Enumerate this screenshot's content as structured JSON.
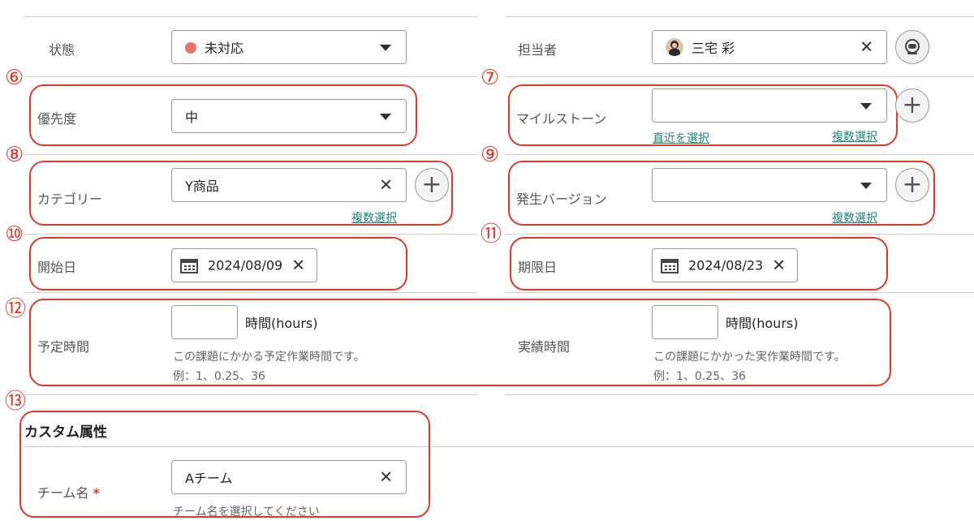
{
  "status": {
    "label": "状態",
    "value": "未対応",
    "dot_color": "#e8736a"
  },
  "assignee": {
    "label": "担当者",
    "value": "三宅 彩"
  },
  "priority": {
    "label": "優先度",
    "value": "中",
    "number": "⑥"
  },
  "milestone": {
    "label": "マイルストーン",
    "value": "",
    "recent_link": "直近を選択",
    "multi_link": "複数選択",
    "number": "⑦"
  },
  "category": {
    "label": "カテゴリー",
    "value": "Y商品",
    "multi_link": "複数選択",
    "number": "⑧"
  },
  "version": {
    "label": "発生バージョン",
    "value": "",
    "multi_link": "複数選択",
    "number": "⑨"
  },
  "start_date": {
    "label": "開始日",
    "value": "2024/08/09",
    "number": "⑩"
  },
  "due_date": {
    "label": "期限日",
    "value": "2024/08/23",
    "number": "⑪"
  },
  "time": {
    "number": "⑫",
    "estimated": {
      "label": "予定時間",
      "unit": "時間(hours)",
      "help1": "この課題にかかる予定作業時間です。",
      "help2": "例：1、0.25、36"
    },
    "actual": {
      "label": "実績時間",
      "unit": "時間(hours)",
      "help1": "この課題にかかった実作業時間です。",
      "help2": "例：1、0.25、36"
    }
  },
  "custom": {
    "number": "⑬",
    "heading": "カスタム属性",
    "team_label": "チーム名",
    "required_mark": "*",
    "team_value": "Aチーム",
    "team_help": "チーム名を選択してください"
  },
  "colors": {
    "accent_red": "#e2372b",
    "link_green": "#1d8a72"
  }
}
